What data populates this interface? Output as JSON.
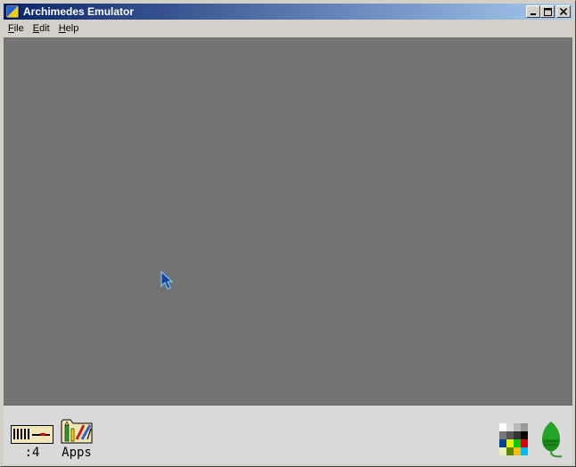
{
  "window": {
    "title": "Archimedes Emulator",
    "controls": {
      "minimize": "_",
      "maximize": "□",
      "close": "✕"
    }
  },
  "menu": {
    "file": "File",
    "file_mnemonic": "F",
    "file_rest": "ile",
    "edit_mnemonic": "E",
    "edit_rest": "dit",
    "help_mnemonic": "H",
    "help_rest": "elp"
  },
  "iconbar": {
    "drive_label": ":4",
    "apps_label": "Apps"
  },
  "icons": {
    "app": "archimedes-app-icon",
    "drive": "floppy-drive-icon",
    "apps": "apps-folder-icon",
    "palette": "palette-icon",
    "acorn": "acorn-icon",
    "cursor": "mouse-pointer-icon"
  },
  "colors": {
    "titlebar_start": "#0a246a",
    "titlebar_end": "#a6caf0",
    "desktop": "#737373",
    "iconbar": "#d9d9d9"
  }
}
